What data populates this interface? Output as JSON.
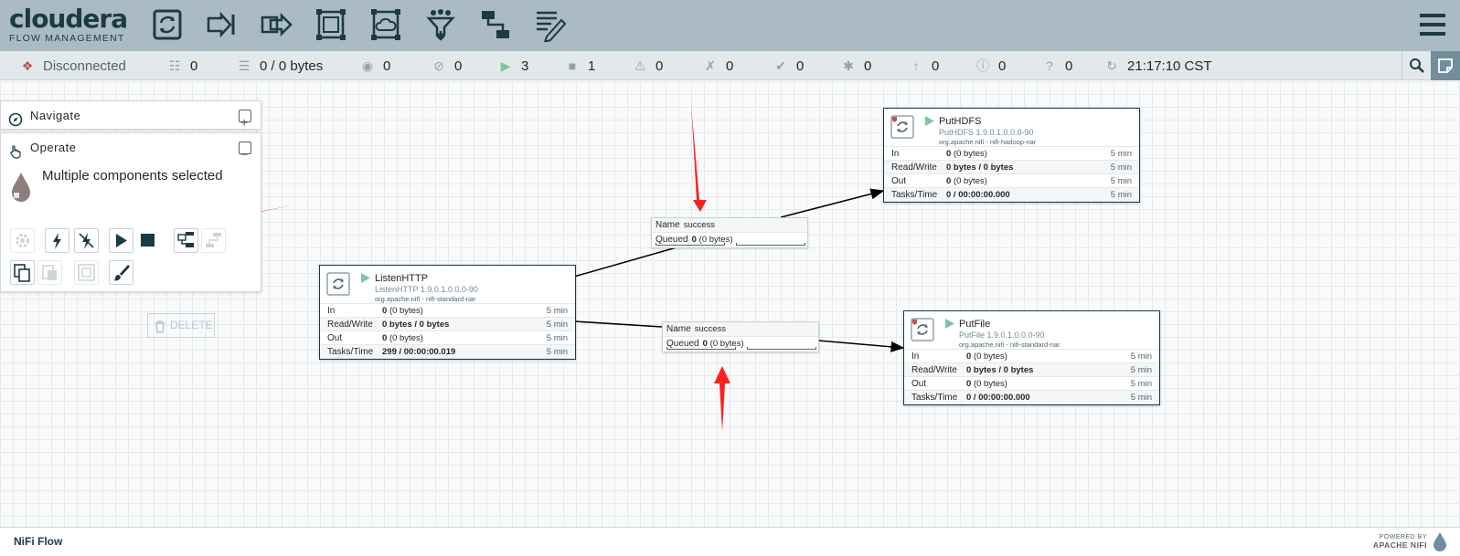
{
  "header": {
    "brand": "cloudera",
    "brand_sub": "FLOW MANAGEMENT",
    "toolbar_icons": [
      "processor-icon",
      "input-port-icon",
      "output-port-icon",
      "process-group-icon",
      "remote-process-group-icon",
      "funnel-icon",
      "template-icon",
      "label-icon"
    ]
  },
  "status": {
    "cluster": "Disconnected",
    "active_threads": "0",
    "queued": "0 / 0 bytes",
    "transmitting": "0",
    "not_transmitting": "0",
    "running": "3",
    "stopped": "1",
    "invalid": "0",
    "disabled": "0",
    "up_to_date": "0",
    "locally_modified": "0",
    "stale": "0",
    "locally_modified_stale": "0",
    "sync_failure": "0",
    "last_refresh": "21:17:10 CST"
  },
  "navigate": {
    "title": "Navigate"
  },
  "operate": {
    "title": "Operate",
    "selection": "Multiple components selected",
    "delete_label": "DELETE"
  },
  "processors": [
    {
      "name": "ListenHTTP",
      "type": "ListenHTTP 1.9.0.1.0.0.0-90",
      "bundle": "org.apache.nifi - nifi-standard-nar",
      "in": "0",
      "in_bytes": "(0 bytes)",
      "rw": "0 bytes / 0 bytes",
      "out": "0",
      "out_bytes": "(0 bytes)",
      "tasks": "299 / 00:00:00.019",
      "window": "5 min"
    },
    {
      "name": "PutHDFS",
      "type": "PutHDFS 1.9.0.1.0.0.0-90",
      "bundle": "org.apache.nifi - nifi-hadoop-nar",
      "in": "0",
      "in_bytes": "(0 bytes)",
      "rw": "0 bytes / 0 bytes",
      "out": "0",
      "out_bytes": "(0 bytes)",
      "tasks": "0 / 00:00:00.000",
      "window": "5 min"
    },
    {
      "name": "PutFile",
      "type": "PutFile 1.9.0.1.0.0.0-90",
      "bundle": "org.apache.nifi - nifi-standard-nar",
      "in": "0",
      "in_bytes": "(0 bytes)",
      "rw": "0 bytes / 0 bytes",
      "out": "0",
      "out_bytes": "(0 bytes)",
      "tasks": "0 / 00:00:00.000",
      "window": "5 min"
    }
  ],
  "stat_labels": {
    "in": "In",
    "rw": "Read/Write",
    "out": "Out",
    "tasks": "Tasks/Time"
  },
  "connections": [
    {
      "name_label": "Name",
      "name": "success",
      "queued_label": "Queued",
      "queued": "0",
      "queued_bytes": "(0 bytes)"
    },
    {
      "name_label": "Name",
      "name": "success",
      "queued_label": "Queued",
      "queued": "0",
      "queued_bytes": "(0 bytes)"
    }
  ],
  "footer": {
    "breadcrumb": "NiFi Flow",
    "powered_line1": "POWERED BY",
    "powered_line2": "APACHE NIFI"
  },
  "colors": {
    "header_bg": "#aabbc3",
    "brand": "#1c3a45",
    "running": "#7dc7a0",
    "disconnected": "#ba554a",
    "annotation_arrow": "#ff1f1f"
  }
}
